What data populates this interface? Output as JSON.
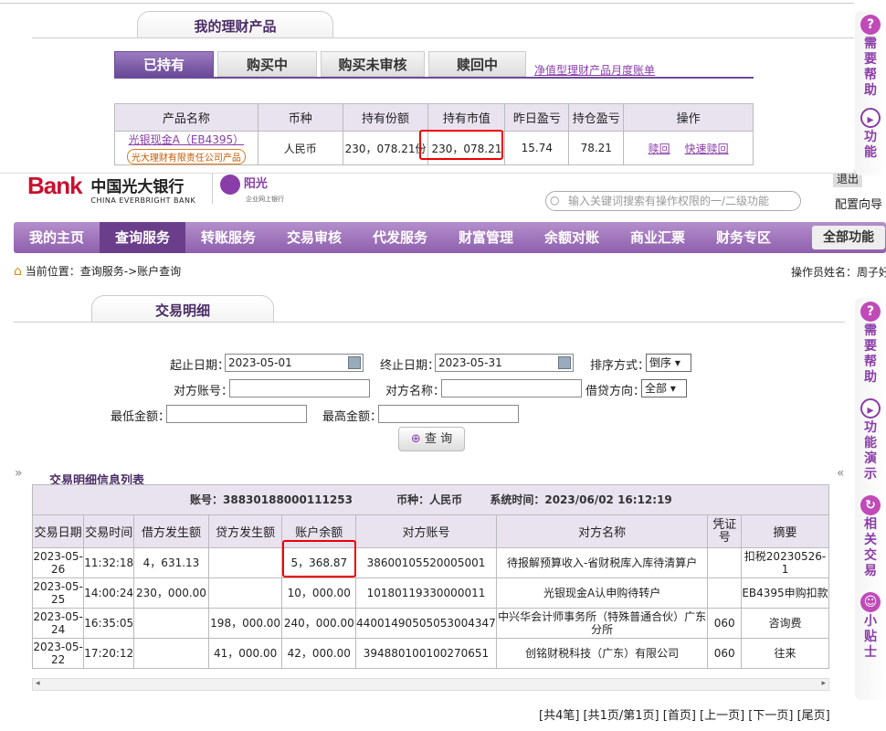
{
  "wealth": {
    "title": "我的理财产品",
    "tabs": [
      "已持有",
      "购买中",
      "购买未审核",
      "赎回中"
    ],
    "link": "净值型理财产品月度账单",
    "headers": [
      "产品名称",
      "币种",
      "持有份额",
      "持有市值",
      "昨日盈亏",
      "持仓盈亏",
      "操作"
    ],
    "row": {
      "name": "光银现金A（EB4395）",
      "badge": "光大理财有限责任公司产品",
      "currency": "人民币",
      "shares": "230，078.21份",
      "value": "230，078.21",
      "yday": "15.74",
      "total": "78.21",
      "op1": "赎回",
      "op2": "快速赎回"
    }
  },
  "header": {
    "bank_word": "Bank",
    "bank_cn": "中国光大银行",
    "bank_en": "CHINA EVERBRIGHT BANK",
    "brand": "阳光",
    "brand_sub": "企业网上银行",
    "search_placeholder": "输入关键词搜索有操作权限的一/二级功能",
    "config": "配置向导",
    "exit": "退出"
  },
  "nav": {
    "items": [
      "我的主页",
      "查询服务",
      "转账服务",
      "交易审核",
      "代发服务",
      "财富管理",
      "余额对账",
      "商业汇票",
      "财务专区"
    ],
    "all": "全部功能"
  },
  "breadcrumb": {
    "prefix": "当前位置：",
    "path": "查询服务->账户查询",
    "operator": "操作员姓名：周子好"
  },
  "detail": {
    "title": "交易明细",
    "form": {
      "start_label": "起止日期：",
      "start": "2023-05-01",
      "end_label": "终止日期：",
      "end": "2023-05-31",
      "sort_label": "排序方式：",
      "sort": "倒序",
      "acct_label": "对方账号：",
      "name_label": "对方名称：",
      "dir_label": "借贷方向：",
      "dir": "全部",
      "min_label": "最低金额：",
      "max_label": "最高金额：",
      "query": "查 询"
    },
    "list_title": "交易明细信息列表",
    "info": {
      "account": "账号：38830188000111253",
      "currency": "币种：人民币",
      "time": "系统时间：2023/06/02  16:12:19"
    },
    "headers": [
      "交易日期",
      "交易时间",
      "借方发生额",
      "贷方发生额",
      "账户余额",
      "对方账号",
      "对方名称",
      "凭证号",
      "摘要"
    ],
    "rows": [
      [
        "2023-05-26",
        "11:32:18",
        "4，631.13",
        "",
        "5，368.87",
        "38600105520005001",
        "待报解预算收入-省财税库入库待清算户",
        "",
        "扣税20230526-1"
      ],
      [
        "2023-05-25",
        "14:00:24",
        "230，000.00",
        "",
        "10，000.00",
        "10180119330000011",
        "光银现金A认申购待转户",
        "",
        "EB4395申购扣款"
      ],
      [
        "2023-05-24",
        "16:35:05",
        "",
        "198，000.00",
        "240，000.00",
        "44001490505053004347",
        "中兴华会计师事务所（特殊普通合伙）广东分所",
        "060",
        "咨询费"
      ],
      [
        "2023-05-22",
        "17:20:12",
        "",
        "41，000.00",
        "42，000.00",
        "39488010010027065​1",
        "创铭财税科技（广东）有限公司",
        "060",
        "往来"
      ]
    ],
    "pager": "[共4笔] [共1页/第1页] [首页] [上一页] [下一页] [尾页]"
  },
  "side_top": [
    "需要帮助",
    "功能"
  ],
  "side": [
    "需要帮助",
    "功能演示",
    "相关交易",
    "小贴士"
  ]
}
